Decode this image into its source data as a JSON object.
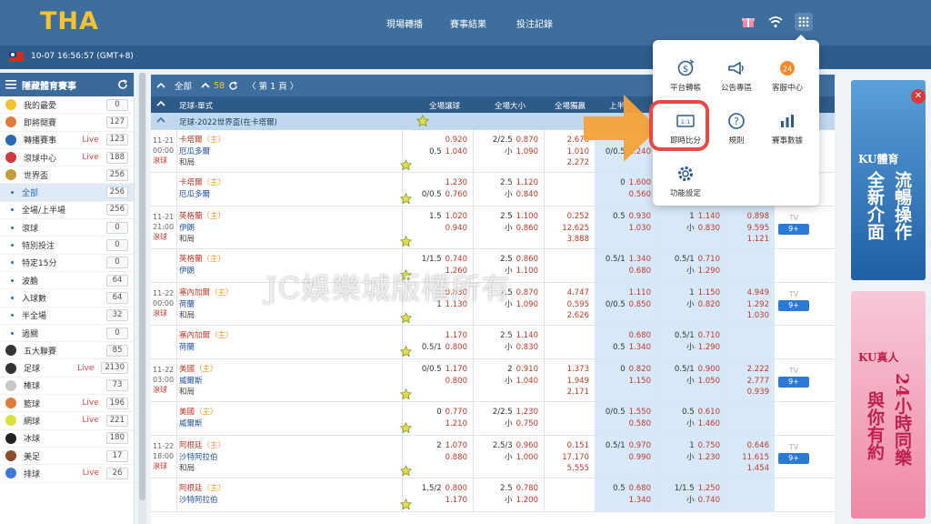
{
  "app": {
    "logo": "THA"
  },
  "nav": {
    "items": [
      "現場轉播",
      "賽事結果",
      "投注記錄"
    ]
  },
  "header": {
    "datetime": "10-07 16:56:57 (GMT+8)"
  },
  "sidebar": {
    "title": "隱藏體育賽事",
    "items": [
      {
        "label": "我的最愛",
        "count": "0",
        "live": "",
        "icon": "star-icon",
        "color": "#f2c230"
      },
      {
        "label": "即將開賽",
        "count": "127",
        "live": "",
        "icon": "clock-icon",
        "color": "#e07b39"
      },
      {
        "label": "轉播賽事",
        "count": "123",
        "live": "Live",
        "icon": "tv-icon",
        "color": "#2b6bb5"
      },
      {
        "label": "滾球中心",
        "count": "188",
        "live": "Live",
        "icon": "running-icon",
        "color": "#d23b3b"
      },
      {
        "label": "世界盃",
        "count": "256",
        "live": "",
        "icon": "trophy-icon",
        "color": "#c49a3a"
      }
    ],
    "subitems": [
      {
        "label": "全部",
        "count": "256",
        "active": true
      },
      {
        "label": "全場/上半場",
        "count": "256"
      },
      {
        "label": "滾球",
        "count": "0"
      },
      {
        "label": "特別投注",
        "count": "0"
      },
      {
        "label": "特定15分",
        "count": "0"
      },
      {
        "label": "波膽",
        "count": "64"
      },
      {
        "label": "入球數",
        "count": "64"
      },
      {
        "label": "半全場",
        "count": "32"
      },
      {
        "label": "過關",
        "count": "0"
      }
    ],
    "sports": [
      {
        "label": "五大聯賽",
        "count": "85",
        "live": "",
        "icon": "soccer-ball-icon",
        "color": "#333333"
      },
      {
        "label": "足球",
        "count": "2130",
        "live": "Live",
        "icon": "soccer-ball-icon",
        "color": "#333333"
      },
      {
        "label": "棒球",
        "count": "73",
        "live": "",
        "icon": "baseball-icon",
        "color": "#c9c9c9"
      },
      {
        "label": "籃球",
        "count": "196",
        "live": "Live",
        "icon": "basketball-icon",
        "color": "#e07b39"
      },
      {
        "label": "網球",
        "count": "221",
        "live": "Live",
        "icon": "tennis-ball-icon",
        "color": "#d8e23a"
      },
      {
        "label": "冰球",
        "count": "180",
        "live": "",
        "icon": "hockey-puck-icon",
        "color": "#222222"
      },
      {
        "label": "美足",
        "count": "17",
        "live": "",
        "icon": "football-icon",
        "color": "#8b4a2b"
      },
      {
        "label": "排球",
        "count": "26",
        "live": "Live",
        "icon": "volleyball-icon",
        "color": "#3a7bd5"
      }
    ]
  },
  "table": {
    "toolbar": {
      "all": "全部",
      "count": "58",
      "page": "第 1 頁"
    },
    "header": {
      "market": "足球-單式",
      "cols": [
        "全場讓球",
        "全場大小",
        "全場獨贏",
        "上半",
        "上半",
        "上半"
      ]
    },
    "league": "足球-2022世界盃(在卡塔爾)",
    "rows": [
      {
        "date": "11-21",
        "time": "00:00",
        "status": "滾球",
        "home": "卡塔爾",
        "homeTag": "（主）",
        "away": "厄瓜多爾",
        "draw": "和局",
        "hc": [
          "0.920",
          "0.5 1.040"
        ],
        "ou": [
          "2/2.5 0.870",
          "小 1.090"
        ],
        "ml": [
          "2.676",
          "1.010",
          "2.272"
        ],
        "h1hc": [
          "",
          "0/0.5 1.240"
        ],
        "h1ou": [
          "",
          ""
        ],
        "h1ml": [
          "",
          "",
          ""
        ],
        "tv": false
      },
      {
        "date": "",
        "time": "",
        "status": "",
        "home": "卡塔爾",
        "homeTag": "（主）",
        "away": "厄瓜多爾",
        "draw": "",
        "hc": [
          "1.230",
          "0/0.5 0.760"
        ],
        "ou": [
          "2.5 1.120",
          "小 0.840"
        ],
        "ml": [
          "",
          "",
          ""
        ],
        "h1hc": [
          "0 1.600",
          "0.560"
        ],
        "h1ou": [
          "",
          ""
        ],
        "h1ml": [
          "",
          "",
          ""
        ],
        "tv": false
      },
      {
        "date": "11-21",
        "time": "21:00",
        "status": "滾球",
        "home": "英格蘭",
        "homeTag": "（主）",
        "away": "伊朗",
        "draw": "和局",
        "hc": [
          "1.5 1.020",
          "0.940"
        ],
        "ou": [
          "2.5 1.100",
          "小 0.860"
        ],
        "ml": [
          "0.252",
          "12.625",
          "3.888"
        ],
        "h1hc": [
          "0.5 0.930",
          "1.030"
        ],
        "h1ou": [
          "1 1.140",
          "小 0.830"
        ],
        "h1ml": [
          "0.898",
          "9.595",
          "1.121"
        ],
        "tv": true
      },
      {
        "date": "",
        "time": "",
        "status": "",
        "home": "英格蘭",
        "homeTag": "（主）",
        "away": "伊朗",
        "draw": "",
        "hc": [
          "1/1.5 0.740",
          "1.260"
        ],
        "ou": [
          "2.5 0.860",
          "小 1.100"
        ],
        "ml": [
          "",
          "",
          ""
        ],
        "h1hc": [
          "0.5/1 1.340",
          "0.680"
        ],
        "h1ou": [
          "0.5/1 0.710",
          "小 1.290"
        ],
        "h1ml": [
          "",
          "",
          ""
        ],
        "tv": false
      },
      {
        "date": "11-22",
        "time": "00:00",
        "status": "滾球",
        "home": "塞內加爾",
        "homeTag": "（主）",
        "away": "荷蘭",
        "draw": "和局",
        "hc": [
          "0.830",
          "1 1.130"
        ],
        "ou": [
          "2.5 0.870",
          "小 1.090"
        ],
        "ml": [
          "4.747",
          "0.595",
          "2.626"
        ],
        "h1hc": [
          "1.110",
          "0/0.5 0.850"
        ],
        "h1ou": [
          "1 1.150",
          "小 0.820"
        ],
        "h1ml": [
          "4.949",
          "1.292",
          "1.030"
        ],
        "tv": true
      },
      {
        "date": "",
        "time": "",
        "status": "",
        "home": "塞內加爾",
        "homeTag": "（主）",
        "away": "荷蘭",
        "draw": "",
        "hc": [
          "1.170",
          "0.5/1 0.800"
        ],
        "ou": [
          "2.5 1.140",
          "小 0.830"
        ],
        "ml": [
          "",
          "",
          ""
        ],
        "h1hc": [
          "0.680",
          "0.5 1.340"
        ],
        "h1ou": [
          "0.5/1 0.710",
          "小 1.290"
        ],
        "h1ml": [
          "",
          "",
          ""
        ],
        "tv": false
      },
      {
        "date": "11-22",
        "time": "03:00",
        "status": "滾球",
        "home": "美國",
        "homeTag": "（主）",
        "away": "威爾斯",
        "draw": "和局",
        "hc": [
          "0/0.5 1.170",
          "0.800"
        ],
        "ou": [
          "2 0.910",
          "小 1.040"
        ],
        "ml": [
          "1.373",
          "1.949",
          "2.171"
        ],
        "h1hc": [
          "0 0.820",
          "1.150"
        ],
        "h1ou": [
          "0.5/1 0.900",
          "小 1.050"
        ],
        "h1ml": [
          "2.222",
          "2.777",
          "0.939"
        ],
        "tv": true
      },
      {
        "date": "",
        "time": "",
        "status": "",
        "home": "美國",
        "homeTag": "（主）",
        "away": "威爾斯",
        "draw": "",
        "hc": [
          "0 0.770",
          "1.210"
        ],
        "ou": [
          "2/2.5 1.230",
          "小 0.750"
        ],
        "ml": [
          "",
          "",
          ""
        ],
        "h1hc": [
          "0/0.5 1.550",
          "0.580"
        ],
        "h1ou": [
          "0.5 0.610",
          "小 1.460"
        ],
        "h1ml": [
          "",
          "",
          ""
        ],
        "tv": false
      },
      {
        "date": "11-22",
        "time": "18:00",
        "status": "滾球",
        "home": "阿根廷",
        "homeTag": "（主）",
        "away": "沙特阿拉伯",
        "draw": "和局",
        "hc": [
          "2 1.070",
          "0.880"
        ],
        "ou": [
          "2.5/3 0.960",
          "小 1.000"
        ],
        "ml": [
          "0.151",
          "17.170",
          "5.555"
        ],
        "h1hc": [
          "0.5/1 0.970",
          "0.990"
        ],
        "h1ou": [
          "1 0.750",
          "小 1.230"
        ],
        "h1ml": [
          "0.646",
          "11.615",
          "1.454"
        ],
        "tv": true
      },
      {
        "date": "",
        "time": "",
        "status": "",
        "home": "阿根廷",
        "homeTag": "（主）",
        "away": "沙特阿拉伯",
        "draw": "",
        "hc": [
          "1.5/2 0.800",
          "1.170"
        ],
        "ou": [
          "2.5 0.780",
          "小 1.200"
        ],
        "ml": [
          "",
          "",
          ""
        ],
        "h1hc": [
          "0.5 0.680",
          "1.340"
        ],
        "h1ou": [
          "1/1.5 1.250",
          "小 0.740"
        ],
        "h1ml": [
          "",
          "",
          ""
        ],
        "tv": false
      }
    ],
    "tv_label": "TV",
    "more_label": "9+"
  },
  "watermark": "JC娛樂城版權所有",
  "popup": {
    "items": [
      {
        "label": "平台轉帳",
        "icon": "transfer-icon"
      },
      {
        "label": "公告專區",
        "icon": "megaphone-icon"
      },
      {
        "label": "客服中心",
        "icon": "support-24-icon"
      },
      {
        "label": "即時比分",
        "icon": "live-score-icon",
        "badge": "1:1"
      },
      {
        "label": "規則",
        "icon": "help-icon"
      },
      {
        "label": "賽事數據",
        "icon": "stats-icon"
      },
      {
        "label": "功能設定",
        "icon": "settings-icon"
      }
    ],
    "badge24": "24"
  },
  "ad": {
    "top_brand": "KU體育",
    "top_lines": [
      "全新介面",
      "流暢操作"
    ],
    "bottom_brand": "KU真人",
    "bottom_lines": [
      "與你有約",
      "24小時同樂"
    ],
    "close": "✕"
  },
  "colors": {
    "accent": "#3e6e9e",
    "live": "#e04848",
    "highlight": "#e54a45",
    "arrow": "#f5a23a"
  }
}
